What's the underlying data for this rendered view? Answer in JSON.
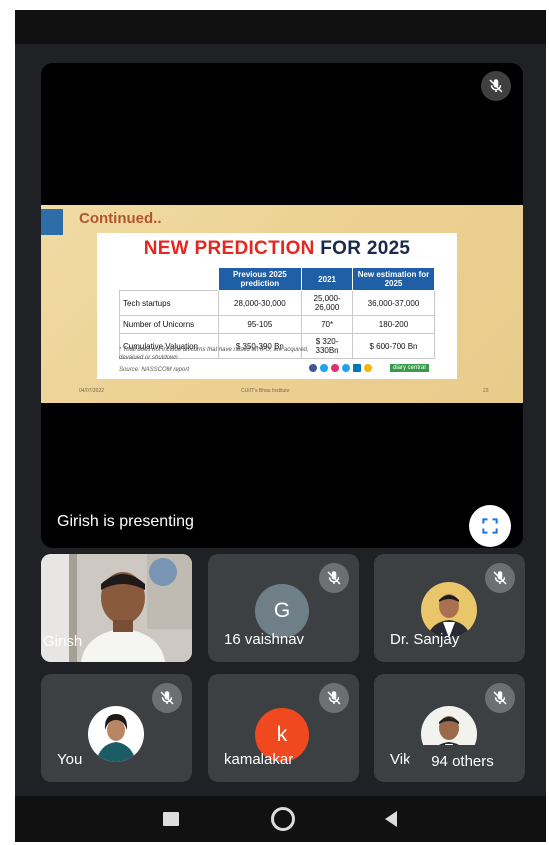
{
  "presenter": {
    "status_text": "Girish is presenting",
    "fullscreen_icon": "fullscreen-icon"
  },
  "slide": {
    "heading": "Continued..",
    "title_red": "NEW PREDICTION",
    "title_dark": " FOR 2025",
    "table": {
      "headers": [
        "",
        "Previous 2025 prediction",
        "2021",
        "New estimation for 2025"
      ],
      "rows": [
        [
          "Tech startups",
          "28,000-30,000",
          "25,000-26,000",
          "36,000-37,000"
        ],
        [
          "Number of Unicorns",
          "95-105",
          "70*",
          "180-200"
        ],
        [
          "Cumulative Valuation",
          "$ 350-390 Bn",
          "$ 320-330Bn",
          "$ 600-700 Bn"
        ]
      ]
    },
    "footnote": "* Total does not include unicorns that have raised an IPO, are acquired, devalued or shutdown",
    "source": "Source: NASSCOM report",
    "brand_label": "diary central",
    "footer_date": "04/07/2022",
    "footer_center": "CUIIT's Bhau Institute",
    "footer_page": "23"
  },
  "participants": [
    {
      "name": "Girish",
      "type": "video"
    },
    {
      "name": "16 vaishnav",
      "initial": "G",
      "avatar_color": "#6f7f88"
    },
    {
      "name": "Dr. Sanjay",
      "type": "photo"
    },
    {
      "name": "You",
      "type": "photo"
    },
    {
      "name": "kamalakar",
      "initial": "k",
      "avatar_color": "#f0491f"
    },
    {
      "name": "Vik",
      "type": "photo"
    }
  ],
  "others_label": "94 others",
  "colors": {
    "background": "#202124",
    "tile": "#3c4043",
    "slide_title_red": "#e5271f",
    "table_header": "#1e5fa6"
  }
}
